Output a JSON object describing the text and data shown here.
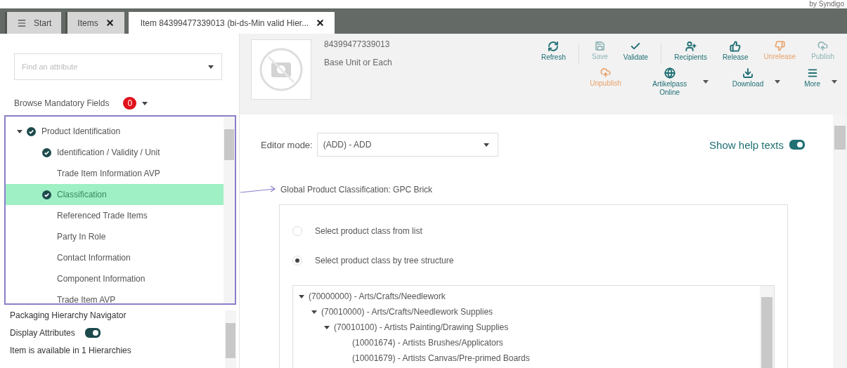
{
  "brand": "by Syndigo",
  "tabs": [
    {
      "label": "Start",
      "kind": "menu",
      "closable": false,
      "selected": false
    },
    {
      "label": "Items",
      "kind": "plain",
      "closable": true,
      "selected": false
    },
    {
      "label": "Item 84399477339013 (bi-ds-Min valid Hier...",
      "kind": "plain",
      "closable": true,
      "selected": true
    }
  ],
  "attribute_search": {
    "placeholder": "Find an attribute"
  },
  "mandatory": {
    "label": "Browse Mandatory Fields",
    "count": "0"
  },
  "navigation": [
    {
      "label": "Product Identification",
      "checked": true,
      "expanded": true,
      "selected": false,
      "children": [
        {
          "label": "Identification / Validity / Unit",
          "checked": true,
          "selected": false
        },
        {
          "label": "Trade Item Information AVP",
          "checked": false,
          "selected": false
        },
        {
          "label": "Classification",
          "checked": true,
          "selected": true
        },
        {
          "label": "Referenced Trade Items",
          "checked": false,
          "selected": false
        },
        {
          "label": "Party In Role",
          "checked": false,
          "selected": false
        },
        {
          "label": "Contact Information",
          "checked": false,
          "selected": false
        },
        {
          "label": "Component Information",
          "checked": false,
          "selected": false
        },
        {
          "label": "Trade Item AVP",
          "checked": false,
          "selected": false
        }
      ]
    }
  ],
  "packaging": {
    "title": "Packaging Hierarchy Navigator",
    "display_attributes": {
      "label": "Display Attributes",
      "on": true
    },
    "note": "Item is available in 1 Hierarchies"
  },
  "item": {
    "gtin": "84399477339013",
    "unit": "Base Unit or Each"
  },
  "toolbar": [
    [
      [
        {
          "label": "Refresh",
          "kind": "refresh",
          "disabled": false,
          "color": "#1f6f73",
          "has_menu": false
        }
      ],
      [
        {
          "label": "Save",
          "kind": "save",
          "disabled": true,
          "color": "#8fb3b5",
          "has_menu": false
        },
        {
          "label": "Validate",
          "kind": "check",
          "disabled": false,
          "color": "#1f6f73",
          "has_menu": false
        }
      ],
      [
        {
          "label": "Recipients",
          "kind": "recipients",
          "disabled": false,
          "color": "#1f6f73",
          "has_menu": false
        },
        {
          "label": "Release",
          "kind": "thumbs-up",
          "disabled": false,
          "color": "#1f6f73",
          "has_menu": false
        },
        {
          "label": "Unrelease",
          "kind": "thumbs-down",
          "disabled": true,
          "color": "#e9a26a",
          "has_menu": false
        },
        {
          "label": "Publish",
          "kind": "cloud",
          "disabled": true,
          "color": "#8fb3b5",
          "has_menu": false
        }
      ]
    ],
    [
      [
        {
          "label": "Unpublish",
          "kind": "cloud",
          "disabled": true,
          "color": "#e9a26a",
          "has_menu": false
        },
        {
          "label": "Artikelpass Online",
          "kind": "globe",
          "disabled": false,
          "color": "#1f6f73",
          "has_menu": true
        },
        {
          "label": "Download",
          "kind": "download",
          "disabled": false,
          "color": "#1f6f73",
          "has_menu": true
        },
        {
          "label": "More",
          "kind": "menu",
          "disabled": false,
          "color": "#1f6f73",
          "has_menu": true
        }
      ]
    ]
  ],
  "editor_mode": {
    "label": "Editor mode:",
    "value": "(ADD) - ADD"
  },
  "help_texts": {
    "label": "Show help texts",
    "on": true
  },
  "classification": {
    "title": "Global Product Classification: GPC Brick",
    "options": [
      {
        "label": "Select product class from list",
        "selected": false
      },
      {
        "label": "Select product class by tree structure",
        "selected": true
      }
    ],
    "tree": [
      {
        "label": "(70000000) - Arts/Crafts/Needlework",
        "expanded": true,
        "children": [
          {
            "label": "(70010000) - Arts/Crafts/Needlework Supplies",
            "expanded": true,
            "children": [
              {
                "label": "(70010100) - Artists Painting/Drawing Supplies",
                "expanded": true,
                "children": [
                  {
                    "label": "(10001674) - Artists Brushes/Applicators"
                  },
                  {
                    "label": "(10001679) - Artists Canvas/Pre-primed Boards"
                  }
                ]
              }
            ]
          }
        ]
      }
    ]
  }
}
